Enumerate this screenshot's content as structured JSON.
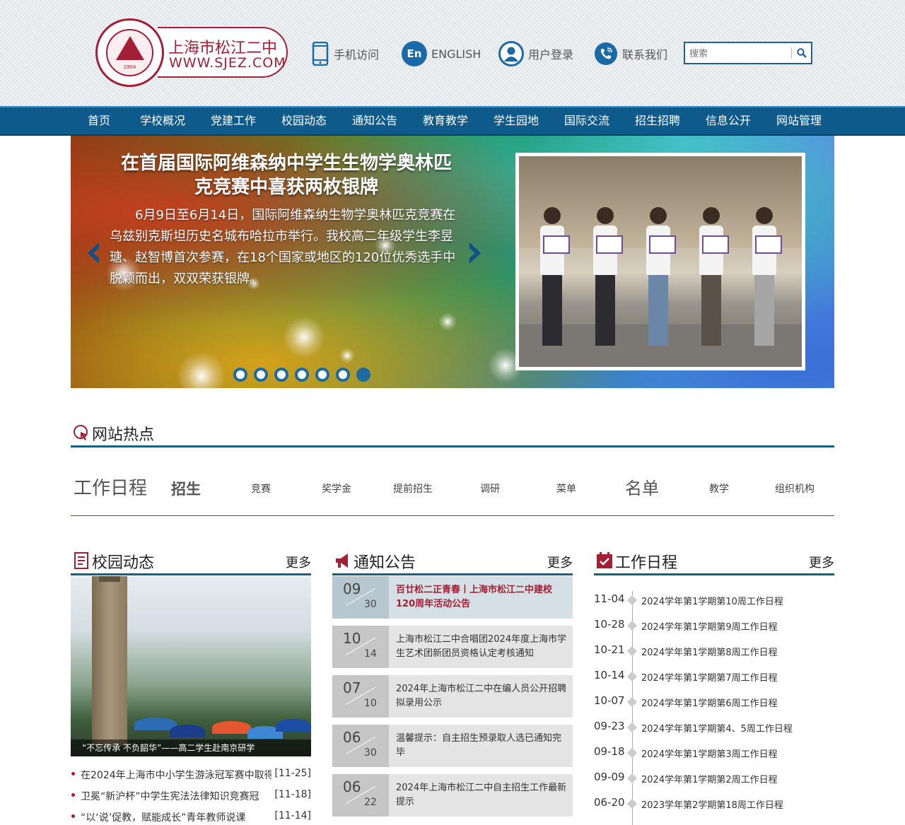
{
  "logo": {
    "cn": "上海市松江二中",
    "url": "WWW.SJEZ.COM",
    "seal_year": "1904",
    "seal_text": "松江二中"
  },
  "utility": {
    "mobile": "手机访问",
    "english_badge": "En",
    "english": "ENGLISH",
    "login": "用户登录",
    "contact": "联系我们"
  },
  "search": {
    "placeholder": "搜索"
  },
  "nav": [
    "首页",
    "学校概况",
    "党建工作",
    "校园动态",
    "通知公告",
    "教育教学",
    "学生园地",
    "国际交流",
    "招生招聘",
    "信息公开",
    "网站管理"
  ],
  "banner": {
    "title": "在首届国际阿维森纳中学生生物学奥林匹克竞赛中喜获两枚银牌",
    "text": "6月9日至6月14日，国际阿维森纳生物学奥林匹克竞赛在乌兹别克斯坦历史名城布哈拉市举行。我校高二年级学生李昱瑭、赵智博首次参赛，在18个国家或地区的120位优秀选手中脱颖而出，双双荣获银牌。",
    "dot_count": 7,
    "active_dot": 7
  },
  "hot": {
    "title": "网站热点",
    "tags": [
      "工作日程",
      "招生",
      "竞赛",
      "奖学金",
      "提前招生",
      "调研",
      "菜单",
      "名单",
      "教学",
      "组织机构"
    ]
  },
  "campus": {
    "title": "校园动态",
    "more": "更多",
    "caption": "“不忘传承 不负韶华”——高二学生赴南京研学",
    "items": [
      {
        "title": "在2024年上海市中小学生游泳冠军赛中取得",
        "date": "[11-25]"
      },
      {
        "title": "卫冕“新沪杯”中学生宪法法律知识竞赛冠",
        "date": "[11-18]"
      },
      {
        "title": "“以‘说’促教，赋能成长”青年教师说课",
        "date": "[11-14]"
      }
    ]
  },
  "notice": {
    "title": "通知公告",
    "more": "更多",
    "items": [
      {
        "month": "09",
        "day": "30",
        "title": "百廿松二正青春丨上海市松江二中建校120周年活动公告"
      },
      {
        "month": "10",
        "day": "14",
        "title": "上海市松江二中合唱团2024年度上海市学生艺术团新团员资格认定考核通知"
      },
      {
        "month": "07",
        "day": "10",
        "title": "2024年上海市松江二中在编人员公开招聘拟录用公示"
      },
      {
        "month": "06",
        "day": "30",
        "title": "温馨提示：自主招生预录取人选已通知完毕"
      },
      {
        "month": "06",
        "day": "22",
        "title": "2024年上海市松江二中自主招生工作最新提示"
      }
    ]
  },
  "schedule": {
    "title": "工作日程",
    "more": "更多",
    "items": [
      {
        "date": "11-04",
        "title": "2024学年第1学期第10周工作日程"
      },
      {
        "date": "10-28",
        "title": "2024学年第1学期第9周工作日程"
      },
      {
        "date": "10-21",
        "title": "2024学年第1学期第8周工作日程"
      },
      {
        "date": "10-14",
        "title": "2024学年第1学期第7周工作日程"
      },
      {
        "date": "10-07",
        "title": "2024学年第1学期第6周工作日程"
      },
      {
        "date": "09-23",
        "title": "2024学年第1学期第4、5周工作日程"
      },
      {
        "date": "09-18",
        "title": "2024学年第1学期第3周工作日程"
      },
      {
        "date": "09-09",
        "title": "2024学年第1学期第2周工作日程"
      },
      {
        "date": "06-20",
        "title": "2023学年第2学期第18周工作日程"
      }
    ]
  },
  "colors": {
    "brand_red": "#a41f35",
    "nav_blue": "#0e5a8a",
    "section_line": "#1b5f7e"
  }
}
